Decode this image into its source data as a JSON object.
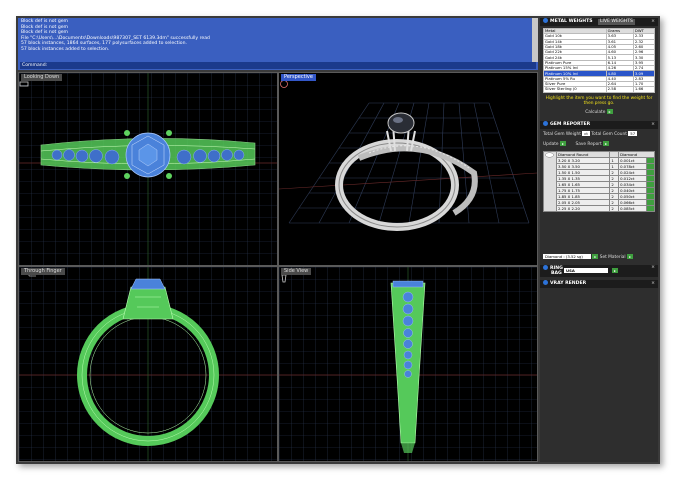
{
  "command": {
    "lines": [
      "Block def is not gem",
      "Block def is not gem",
      "Block def is not gem",
      "File \"C:\\Users\\...\\Documents\\Downloads\\987307_SET 6139.3dm\" successfully read",
      "57 block instances, 1864 surfaces, 177 polysurfaces added to selection.",
      "57 block instances added to selection."
    ],
    "prompt": "Command:"
  },
  "viewports": {
    "top": "Looking Down",
    "perspective": "Perspective",
    "front": "Through Finger",
    "right": "Side View"
  },
  "metal_panel": {
    "title": "METAL WEIGHTS",
    "tab": "LIVE WEIGHTS",
    "headers": [
      "Metal",
      "Grams",
      "DWT"
    ],
    "rows": [
      [
        "Gold 10k",
        "3.63",
        "2.33"
      ],
      [
        "Gold 14k",
        "3.61",
        "2.32"
      ],
      [
        "Gold 18k",
        "4.05",
        "2.60"
      ],
      [
        "Gold 22k",
        "4.60",
        "2.96"
      ],
      [
        "Gold 24k",
        "5.13",
        "3.30"
      ],
      [
        "Platinum Pure",
        "6.14",
        "3.95"
      ],
      [
        "Platinum 15% Ird",
        "4.26",
        "2.74"
      ],
      [
        "Platinum 10% Ird",
        "4.80",
        "3.09"
      ],
      [
        "Platinum 5% Ru",
        "4.40",
        "2.83"
      ],
      [
        "Silver Pure",
        "2.64",
        "1.70"
      ],
      [
        "Silver Sterling (0",
        "2.58",
        "1.66"
      ]
    ],
    "selected_row": 7,
    "hint": "Highlight the item you want to find the weight for then press go.",
    "calc_label": "Calculate"
  },
  "gem_panel": {
    "title": "GEM REPORTER",
    "total_weight_label": "Total Gem Weight",
    "total_weight_value": "ct",
    "total_count_label": "Total Gem Count",
    "total_count_value": "57",
    "update_label": "Update",
    "save_label": "Save Report",
    "headers": [
      "Diamond Round",
      "",
      "Diamond"
    ],
    "rows": [
      [
        "3.20 X 3.20",
        "1",
        "0.001ct"
      ],
      [
        "3.50 X 3.50",
        "1",
        "0.078ct"
      ],
      [
        "1.50 X 1.50",
        "2",
        "0.024ct"
      ],
      [
        "1.35 X 1.35",
        "2",
        "0.012ct"
      ],
      [
        "1.65 X 1.65",
        "2",
        "0.034ct"
      ],
      [
        "1.75 X 1.75",
        "2",
        "0.040ct"
      ],
      [
        "1.85 X 1.85",
        "2",
        "0.050ct"
      ],
      [
        "2.05 X 2.05",
        "2",
        "0.066ct"
      ],
      [
        "2.25 X 2.20",
        "2",
        "0.085ct"
      ]
    ],
    "material_select": "Diamond : (3.52 sg)",
    "material_btn": "Set Material"
  },
  "ring_panel": {
    "title": "RING",
    "title2": "BAG",
    "size_select": "USA"
  },
  "vray_panel": {
    "title": "VRAY RENDER"
  },
  "colors": {
    "wire_green": "#6de06a",
    "gem_blue": "#4a86e0",
    "grid": "#2f3c58",
    "command_bg": "#3a5fc0"
  }
}
